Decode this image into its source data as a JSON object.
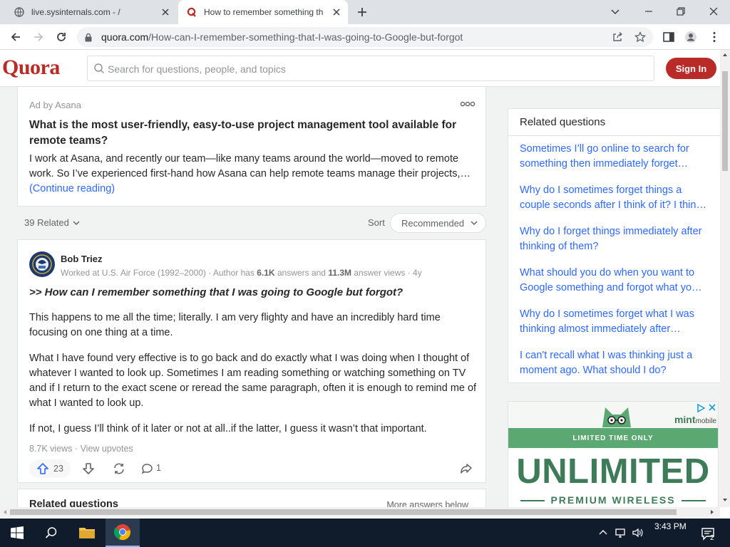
{
  "browser": {
    "tabs": [
      {
        "title": "live.sysinternals.com - /"
      },
      {
        "title": "How to remember something th"
      }
    ],
    "url_domain": "quora.com",
    "url_path": "/How-can-I-remember-something-that-I-was-going-to-Google-but-forgot"
  },
  "quora": {
    "logo": "Quora",
    "search_placeholder": "Search for questions, people, and topics",
    "sign_in": "Sign In"
  },
  "ad": {
    "by": "Ad by Asana",
    "title": "What is the most user-friendly, easy-to-use project management tool available for remote teams?",
    "body": "I work at Asana, and recently our team—like many teams around the world—moved to remote work. So I’ve experienced first-hand how Asana can help remote teams manage their projects,…",
    "continue": "(Continue reading)"
  },
  "listing": {
    "related_count": "39 Related",
    "sort_label": "Sort",
    "sort_value": "Recommended"
  },
  "answer": {
    "author": "Bob Triez",
    "cred_prefix": "Worked at U.S. Air Force (1992–2000) · Author has ",
    "answers_count": "6.1K",
    "answers_mid": " answers and ",
    "views_count": "11.3M",
    "cred_suffix": " answer views · 4y",
    "question": ">> How can I remember something that I was going to Google but forgot?",
    "paragraphs": [
      "This happens to me all the time; literally. I am very flighty and have an incredibly hard time focusing on one thing at a time.",
      "What I have found very effective is to go back and do exactly what I was doing when I thought of whatever I wanted to look up. Sometimes I am reading something or watching something on TV and if I return to the exact scene or reread the same paragraph, often it is enough to remind me of what I wanted to look up.",
      "If not, I guess I’ll think of it later or not at all..if the latter, I guess it wasn’t that important."
    ],
    "views": "8.7K views",
    "view_upvotes": "View upvotes",
    "upvotes": "23",
    "comments": "1"
  },
  "related_bottom": {
    "label": "Related questions",
    "more": "More answers below"
  },
  "sidebar": {
    "title": "Related questions",
    "links": [
      "Sometimes I’ll go online to search for something then immediately forget…",
      "Why do I sometimes forget things a couple seconds after I think of it? I thin…",
      "Why do I forget things immediately after thinking of them?",
      "What should you do when you want to Google something and forgot what yo…",
      "Why do I sometimes forget what I was thinking almost immediately after…",
      "I can't recall what I was thinking just a moment ago. What should I do?"
    ]
  },
  "mint_ad": {
    "brand": "mint",
    "brand_suffix": "mobile",
    "band": "LIMITED TIME ONLY",
    "headline": "UNLIMITED",
    "sub": "PREMIUM WIRELESS"
  },
  "taskbar": {
    "time": "3:43 PM",
    "notifications": "2"
  },
  "colors": {
    "quora_red": "#b92b27",
    "link_blue": "#2e69ff",
    "mint_green": "#3e7b58"
  }
}
